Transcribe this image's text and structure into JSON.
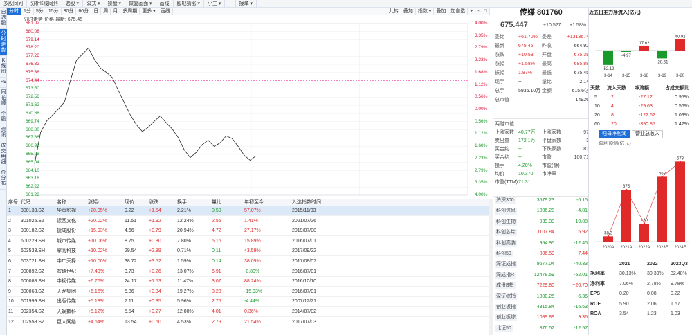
{
  "topmenu": [
    "多股同列",
    "分析K线同列",
    "选股 ▾",
    "公式 ▾",
    "操盘 ▾",
    "恢复画面 ▾",
    "画线",
    "股吧猜涨 ▾",
    "小三 ▾",
    "+",
    "接单 ▾"
  ],
  "leftnav": [
    "自选股",
    "分时走势",
    "K线图",
    "F9",
    "同花顺",
    "个股",
    "资讯",
    "成交明细",
    "价分布"
  ],
  "chart": {
    "tabs": [
      "分时",
      "1分",
      "5分",
      "15分",
      "30分",
      "60分",
      "日",
      "周",
      "月",
      "多周期",
      "更多 ▾",
      "画线"
    ],
    "right_tabs": [
      "九转",
      "叠加",
      "指数 ▾",
      "叠加",
      "加自选",
      "+",
      "-",
      "□"
    ],
    "info": "分时走势 价格 最新: 675.45",
    "left_ticks": [
      "681.02",
      "680.08",
      "679.14",
      "678.20",
      "677.26",
      "676.32",
      "675.38",
      "674.44",
      "673.50",
      "672.56",
      "671.62",
      "670.68",
      "669.74",
      "668.80",
      "667.86",
      "666.92",
      "665.98",
      "665.04",
      "664.10",
      "663.16",
      "662.22",
      "661.28"
    ],
    "right_ticks": [
      "4.00%",
      "3.35%",
      "2.79%",
      "2.23%",
      "1.68%",
      "1.12%",
      "0.56%",
      "0.00%",
      "0.56%",
      "1.12%",
      "1.68%",
      "2.23%",
      "2.79%",
      "3.35%",
      "4.00%"
    ],
    "price_line": [
      664.9,
      668.5,
      669.8,
      670.5,
      671.2,
      672.0,
      674.5,
      676.8,
      677.5,
      678.2,
      676.9,
      675.9,
      675.4,
      674.8,
      673.3,
      671.9,
      670.5,
      669.4,
      668.6,
      669.1,
      669.8,
      670.4,
      669.6,
      668.9,
      667.9,
      666.5,
      665.6,
      666.2,
      667.1,
      667.6,
      666.9,
      667.3,
      668.1,
      667.8,
      666.9,
      665.9,
      665.3,
      665.8
    ]
  },
  "table": {
    "headers": [
      "序号",
      "代码",
      "名称",
      "涨幅↓",
      "现价",
      "涨跌",
      "换手",
      "量比",
      "年初至今",
      "入选指数时间"
    ],
    "rows": [
      [
        "1",
        "300133.SZ",
        "华策影视",
        "+20.05%",
        "9.22",
        "+1.54",
        "2.21%",
        "0.59",
        "57.07%",
        "2015/11/03"
      ],
      [
        "2",
        "301025.SZ",
        "读客文化",
        "+20.02%",
        "11.51",
        "+1.92",
        "12.24%",
        "2.55",
        "1.41%",
        "2021/07/26"
      ],
      [
        "3",
        "300182.SZ",
        "捷成股份",
        "+15.93%",
        "4.66",
        "+0.79",
        "20.94%",
        "4.72",
        "27.17%",
        "2019/07/08"
      ],
      [
        "4",
        "600229.SH",
        "城市传媒",
        "+10.06%",
        "8.75",
        "+0.80",
        "7.80%",
        "5.16",
        "15.89%",
        "2016/07/01"
      ],
      [
        "5",
        "603533.SH",
        "掌阅科技",
        "+10.02%",
        "29.54",
        "+2.89",
        "0.71%",
        "0.11",
        "43.59%",
        "2017/09/22"
      ],
      [
        "6",
        "603721.SH",
        "中广天择",
        "+10.00%",
        "38.72",
        "+3.52",
        "1.59%",
        "0.14",
        "38.09%",
        "2017/08/07"
      ],
      [
        "7",
        "000892.SZ",
        "欢瑞世纪",
        "+7.49%",
        "3.73",
        "+0.26",
        "13.07%",
        "6.91",
        "-8.80%",
        "2016/07/01"
      ],
      [
        "8",
        "600088.SH",
        "中视传媒",
        "+6.76%",
        "24.17",
        "+1.53",
        "11.47%",
        "3.07",
        "88.24%",
        "2016/10/10"
      ],
      [
        "9",
        "300063.SZ",
        "天龙集团",
        "+6.16%",
        "5.86",
        "+0.34",
        "19.27%",
        "3.28",
        "-15.93%",
        "2016/07/01"
      ],
      [
        "10",
        "601999.SH",
        "出版传媒",
        "+5.18%",
        "7.11",
        "+0.35",
        "5.96%",
        "2.75",
        "-4.44%",
        "2007/12/21"
      ],
      [
        "11",
        "002354.SZ",
        "天娱数科",
        "+5.12%",
        "5.54",
        "+0.27",
        "12.80%",
        "4.01",
        "0.36%",
        "2014/07/02"
      ],
      [
        "12",
        "002558.SZ",
        "巨人网络",
        "+4.64%",
        "13.54",
        "+0.60",
        "4.53%",
        "2.79",
        "21.54%",
        "2017/07/03"
      ]
    ]
  },
  "detail": {
    "title": "传媒 801760",
    "price": "675.447",
    "chg": "+10.527",
    "pct": "+1.58%",
    "rows": [
      [
        "委比",
        "+61.70%",
        "委差",
        "+1313674"
      ],
      [
        "最新",
        "675.45",
        "昨收",
        "664.92"
      ],
      [
        "涨跌",
        "+10.53",
        "开盘",
        "675.38"
      ],
      [
        "涨幅",
        "+1.58%",
        "最高",
        "685.88"
      ],
      [
        "振幅",
        "1.87%",
        "最低",
        "675.45"
      ],
      [
        "现手",
        "--",
        "量比",
        "2.14"
      ],
      [
        "总手",
        "5936.10万",
        "金额",
        "615.6亿"
      ],
      [
        "总市值",
        "",
        "",
        "14926"
      ]
    ],
    "stats": [
      [
        "两融市值",
        ""
      ],
      [
        "上涨家数",
        "40.77万",
        "上涨家数",
        "97"
      ],
      [
        "卖出量",
        "172.1万",
        "平盘家数",
        "3"
      ],
      [
        "买合约",
        "--",
        "下跌家数",
        "81"
      ],
      [
        "买合约",
        "--",
        "市盈",
        "100.71"
      ],
      [
        "换手",
        "4.20%",
        "市盈(静)",
        ""
      ],
      [
        "均价",
        "10.370",
        "市净率",
        ""
      ],
      [
        "市盈(TTM)",
        "71.31",
        "",
        ""
      ]
    ],
    "indices": [
      [
        "沪深300",
        "3579.23",
        "-6.15"
      ],
      [
        "科创信息",
        "1006.28",
        "-4.81"
      ],
      [
        "科创生物",
        "939.30",
        "-19.88"
      ],
      [
        "科创芯片",
        "1107.84",
        "5.92"
      ],
      [
        "科创高装",
        "954.95",
        "-12.45"
      ],
      [
        "科创50",
        "806.59",
        "7.44"
      ],
      [
        "深证成指",
        "9677.04",
        "-40.33"
      ],
      [
        "深成指R",
        "12478.59",
        "-52.01"
      ],
      [
        "成份B指",
        "7229.80",
        "+20.70"
      ],
      [
        "深证综指",
        "1800.25",
        "-6.36"
      ],
      [
        "创业板指",
        "4315.84",
        "-15.63"
      ],
      [
        "创业板综",
        "1089.89",
        "9.36"
      ],
      [
        "北证50",
        "876.52",
        "-12.57"
      ]
    ]
  },
  "flow": {
    "title": "近五日主力净流入(亿元)",
    "bars": [
      {
        "label": "3-14",
        "value": -52.19
      },
      {
        "label": "3-15",
        "value": -4.97
      },
      {
        "label": "3-18",
        "value": 17.62
      },
      {
        "label": "3-19",
        "value": -28.51
      },
      {
        "label": "3-20",
        "value": 40.92
      }
    ],
    "table_head": [
      "天数",
      "流入天数",
      "净流额",
      "占成交额比"
    ],
    "table": [
      [
        "5",
        "2",
        "-27.12",
        "0.95%"
      ],
      [
        "10",
        "4",
        "-29.63",
        "0.56%"
      ],
      [
        "20",
        "8",
        "-122.62",
        "1.09%"
      ],
      [
        "60",
        "20",
        "-390.85",
        "1.42%"
      ]
    ],
    "tabs": [
      "归母净利润",
      "营业总收入"
    ],
    "chart_label": "盈利预测(亿元)",
    "profit": [
      {
        "label": "2020A",
        "value": 38.3
      },
      {
        "label": "2021A",
        "value": 375
      },
      {
        "label": "2022A",
        "value": 130
      },
      {
        "label": "2023E",
        "value": 468
      },
      {
        "label": "2024E",
        "value": 578
      }
    ],
    "fin_head": [
      "",
      "2021",
      "2022",
      "2023Q3"
    ],
    "fin": [
      [
        "毛利率",
        "30.13%",
        "30.39%",
        "32.48%"
      ],
      [
        "净利率",
        "7.06%",
        "2.78%",
        "9.78%"
      ],
      [
        "EPS",
        "0.20",
        "0.08",
        "0.22"
      ],
      [
        "ROE",
        "5.90",
        "2.06",
        "1.67"
      ],
      [
        "ROA",
        "3.54",
        "1.23",
        "1.03"
      ]
    ]
  }
}
